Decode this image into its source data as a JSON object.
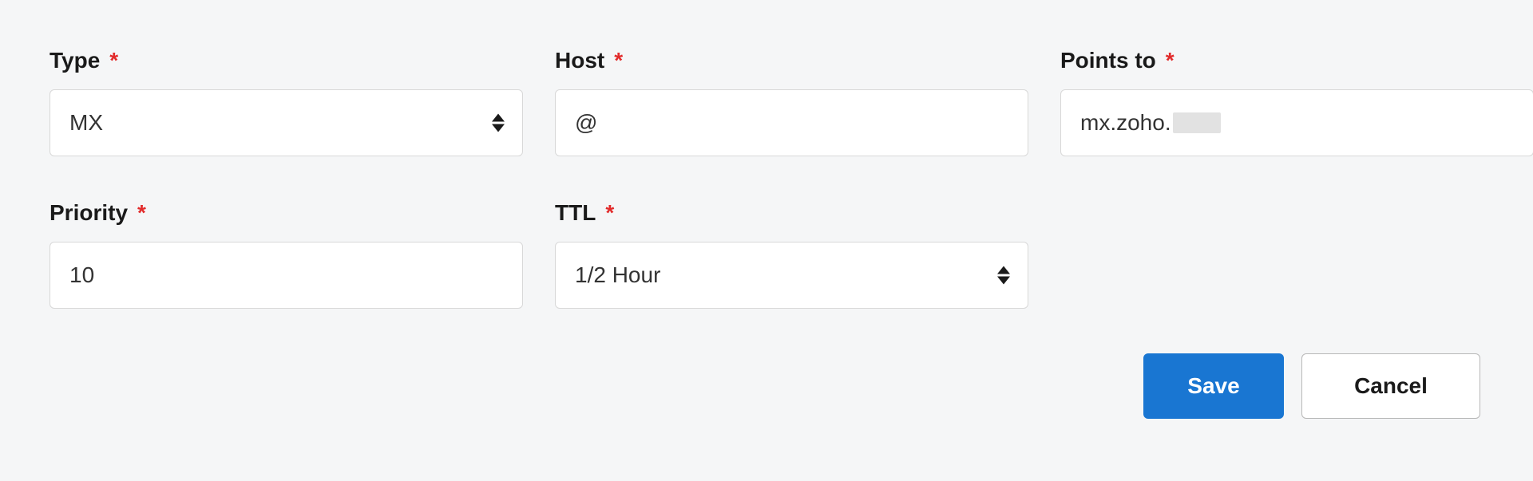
{
  "fields": {
    "type": {
      "label": "Type",
      "value": "MX"
    },
    "host": {
      "label": "Host",
      "value": "@"
    },
    "points_to": {
      "label": "Points to",
      "value": "mx.zoho."
    },
    "priority": {
      "label": "Priority",
      "value": "10"
    },
    "ttl": {
      "label": "TTL",
      "value": "1/2 Hour"
    }
  },
  "required_mark": "*",
  "actions": {
    "save": "Save",
    "cancel": "Cancel"
  }
}
